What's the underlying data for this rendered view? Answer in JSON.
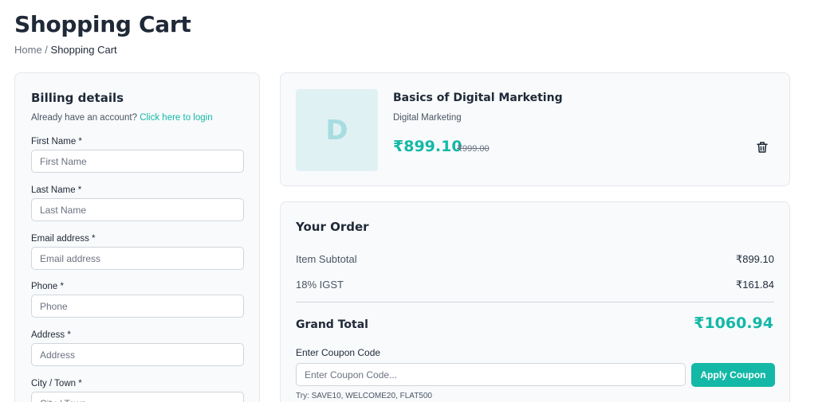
{
  "page": {
    "title": "Shopping Cart",
    "breadcrumb": {
      "home": "Home",
      "separator": " / ",
      "current": "Shopping Cart"
    }
  },
  "billing": {
    "heading": "Billing details",
    "login_prompt": "Already have an account? ",
    "login_link": "Click here to login",
    "fields": [
      {
        "label": "First Name *",
        "placeholder": "First Name"
      },
      {
        "label": "Last Name *",
        "placeholder": "Last Name"
      },
      {
        "label": "Email address *",
        "placeholder": "Email address"
      },
      {
        "label": "Phone *",
        "placeholder": "Phone"
      },
      {
        "label": "Address *",
        "placeholder": "Address"
      },
      {
        "label": "City / Town *",
        "placeholder": "City / Town"
      }
    ]
  },
  "cart_item": {
    "thumbnail_letter": "D",
    "name": "Basics of Digital Marketing",
    "category": "Digital Marketing",
    "price": "₹899.10",
    "original_price": "₹999.00",
    "remove_icon": "trash-icon"
  },
  "order": {
    "heading": "Your Order",
    "subtotal_label": "Item Subtotal",
    "subtotal_value": "₹899.10",
    "tax_label": "18% IGST",
    "tax_value": "₹161.84",
    "grand_total_label": "Grand Total",
    "grand_total_value": "₹1060.94",
    "coupon_label": "Enter Coupon Code",
    "coupon_placeholder": "Enter Coupon Code...",
    "coupon_button": "Apply Coupon",
    "coupon_hint": "Try: SAVE10, WELCOME20, FLAT500"
  },
  "colors": {
    "accent": "#14b8a6",
    "card_bg": "#f8fafc",
    "thumbnail_bg": "#e0f1f3"
  }
}
